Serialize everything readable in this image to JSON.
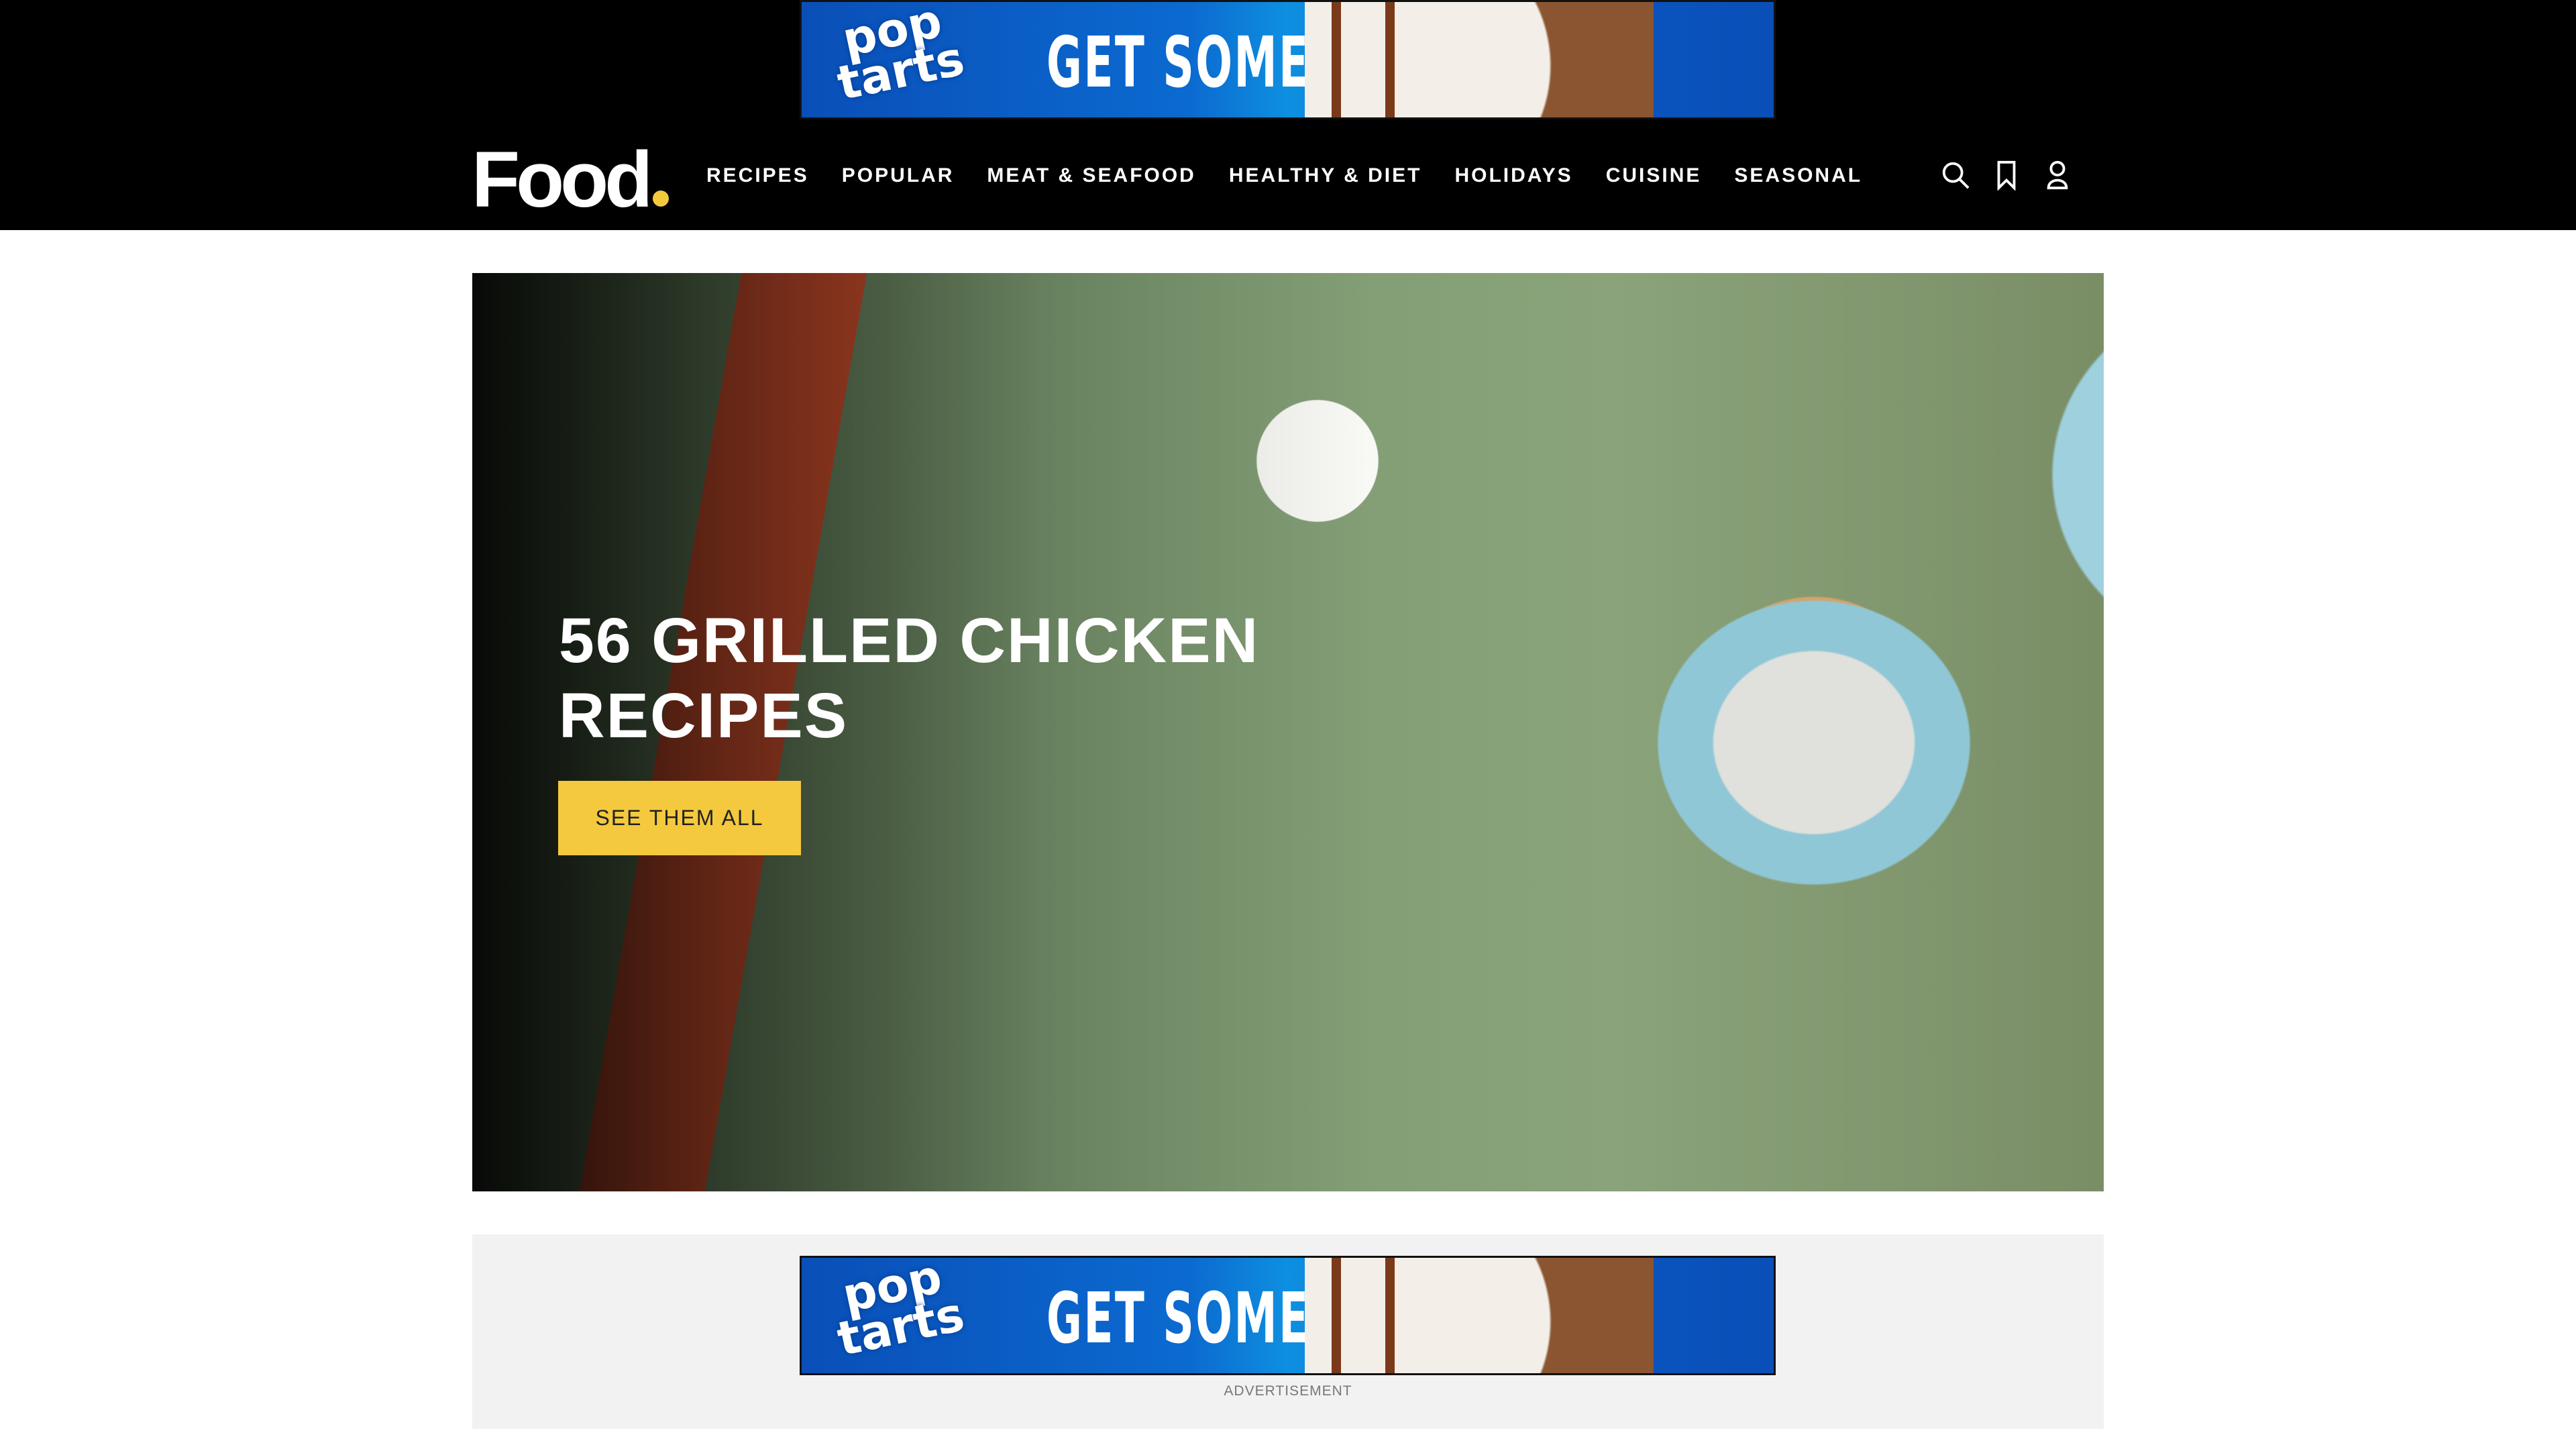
{
  "top_ad": {
    "brand": "pop tarts",
    "cta": "GET SOME >"
  },
  "header": {
    "logo": "Food",
    "nav": [
      "RECIPES",
      "POPULAR",
      "MEAT & SEAFOOD",
      "HEALTHY & DIET",
      "HOLIDAYS",
      "CUISINE",
      "SEASONAL"
    ],
    "icons": [
      "search-icon",
      "bookmark-icon",
      "user-icon"
    ],
    "accent": "#f4c93d"
  },
  "hero": {
    "title": "56 GRILLED CHICKEN RECIPES",
    "button": "SEE THEM ALL"
  },
  "bottom_ad": {
    "brand": "pop tarts",
    "cta": "GET SOME >",
    "label": "ADVERTISEMENT"
  }
}
